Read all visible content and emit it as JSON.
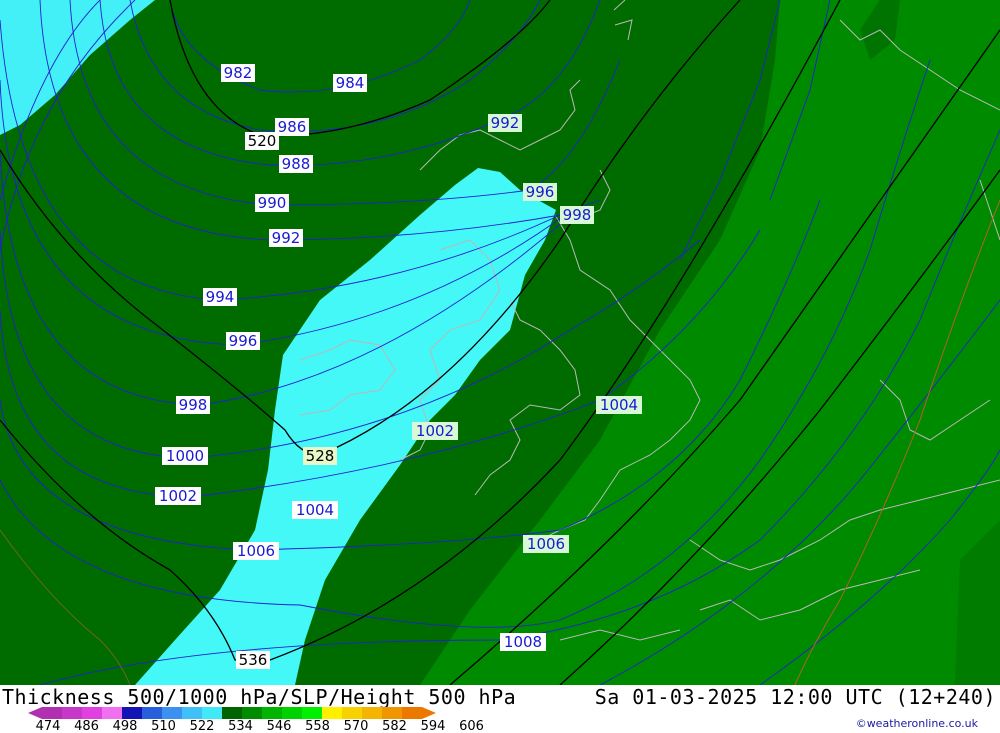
{
  "title": "Thickness 500/1000 hPa/SLP/Height 500 hPa",
  "valid_time": "Sa 01-03-2025 12:00 UTC (12+240)",
  "credit": "©weatheronline.co.uk",
  "colorbar": {
    "labels": [
      "474",
      "486",
      "498",
      "510",
      "522",
      "534",
      "546",
      "558",
      "570",
      "582",
      "594",
      "606"
    ],
    "colors": [
      "#b030b0",
      "#c838c8",
      "#e040e0",
      "#f070f0",
      "#1414b4",
      "#2860dc",
      "#3c90f0",
      "#40c0f8",
      "#40e8f8",
      "#006400",
      "#008c00",
      "#00b400",
      "#00d200",
      "#00f000",
      "#fff000",
      "#f8d200",
      "#f4b400",
      "#f09600",
      "#ec7800"
    ]
  },
  "isobars": [
    {
      "label": "982"
    },
    {
      "label": "984"
    },
    {
      "label": "986"
    },
    {
      "label": "988"
    },
    {
      "label": "990"
    },
    {
      "label": "992"
    },
    {
      "label": "992"
    },
    {
      "label": "994"
    },
    {
      "label": "996"
    },
    {
      "label": "996"
    },
    {
      "label": "998"
    },
    {
      "label": "998"
    },
    {
      "label": "1000"
    },
    {
      "label": "1002"
    },
    {
      "label": "1002"
    },
    {
      "label": "1004"
    },
    {
      "label": "1004"
    },
    {
      "label": "1006"
    },
    {
      "label": "1006"
    },
    {
      "label": "1008"
    }
  ],
  "heights": [
    {
      "label": "520"
    },
    {
      "label": "528"
    },
    {
      "label": "536"
    }
  ]
}
